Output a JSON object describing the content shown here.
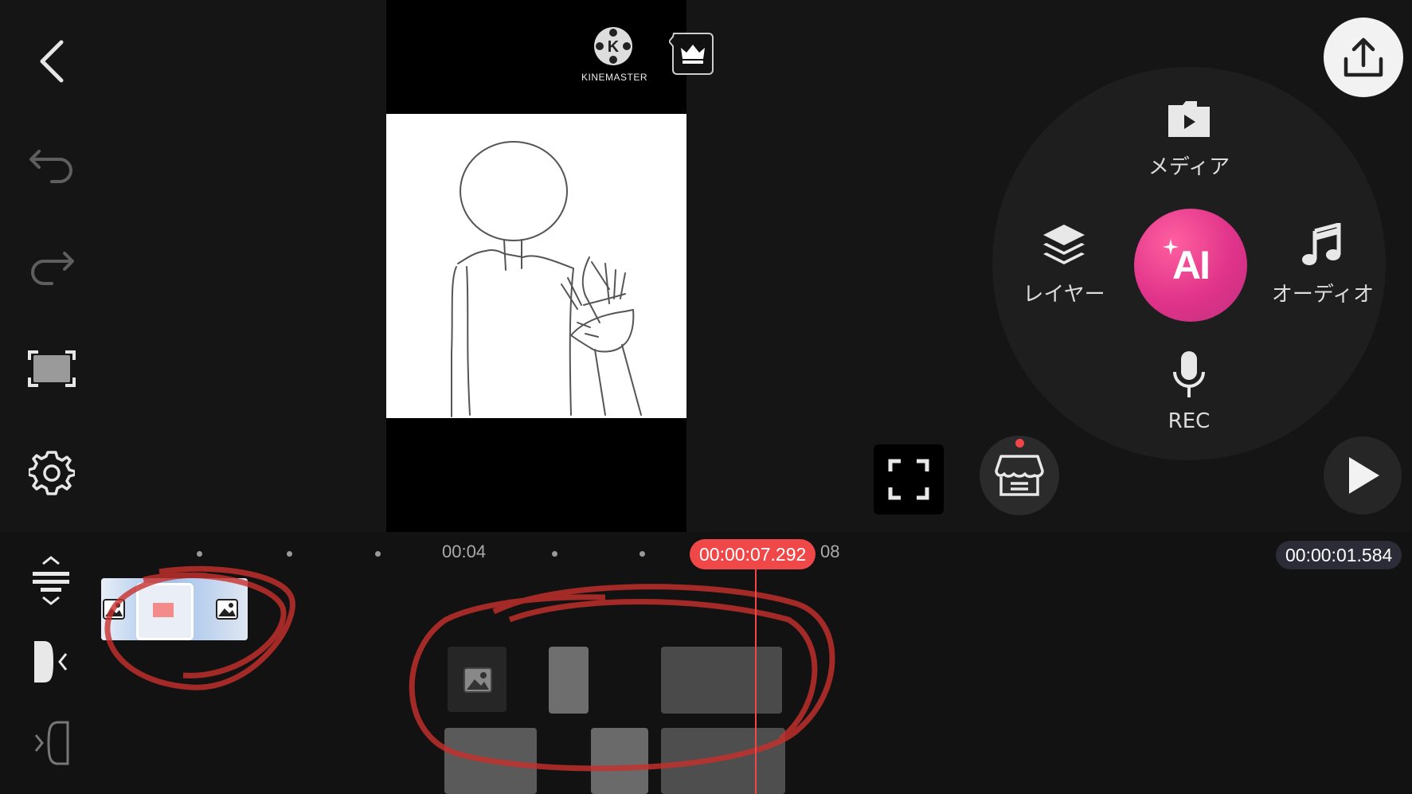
{
  "preview": {
    "brand": "KINEMASTER"
  },
  "wheel": {
    "media_label": "メディア",
    "layer_label": "レイヤー",
    "audio_label": "オーディオ",
    "rec_label": "REC",
    "ai_label": "AI"
  },
  "timeline": {
    "ruler_label_1": "00:04",
    "ruler_label_2": "08",
    "playhead_time": "00:00:07.292",
    "duration": "00:00:01.584"
  },
  "colors": {
    "accent": "#f04848",
    "ai_pink": "#e0338a",
    "background": "#151515"
  },
  "icons": [
    "back-icon",
    "undo-icon",
    "redo-icon",
    "aspect-ratio-icon",
    "settings-icon",
    "export-icon",
    "media-icon",
    "layer-icon",
    "audio-icon",
    "mic-icon",
    "fullscreen-icon",
    "store-icon",
    "play-icon",
    "crown-icon",
    "track-height-icon",
    "trim-left-icon",
    "trim-right-icon"
  ]
}
